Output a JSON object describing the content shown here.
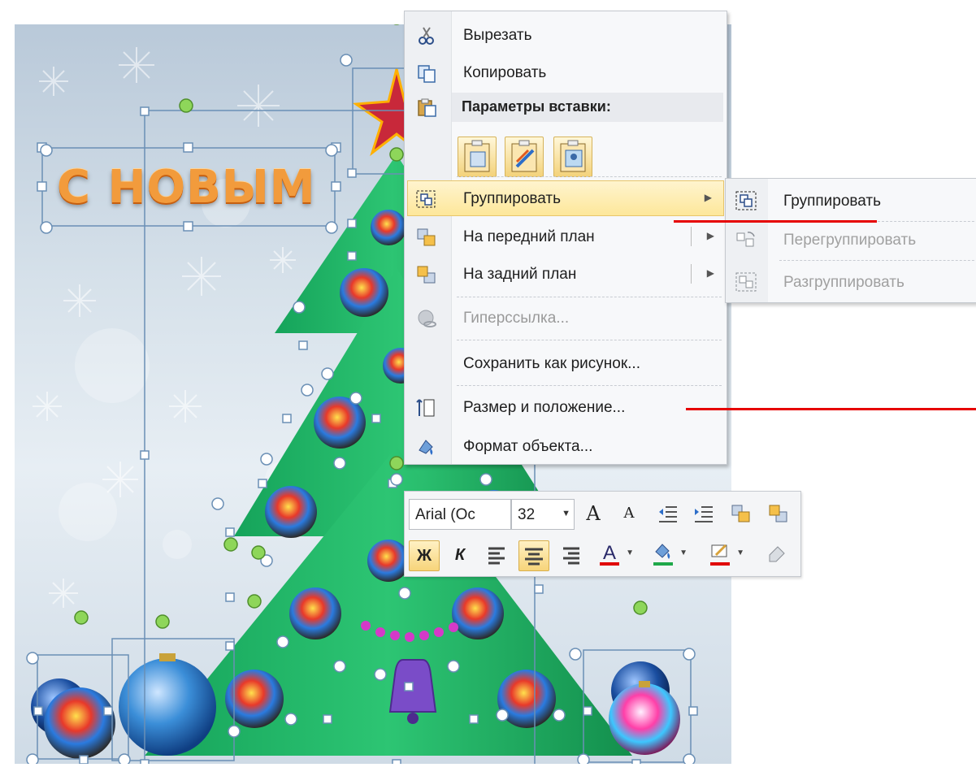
{
  "slide": {
    "title_text": "С НОВЫМ"
  },
  "context_menu": {
    "items": [
      {
        "label": "Вырезать",
        "icon": "scissors-icon"
      },
      {
        "label": "Копировать",
        "icon": "copy-icon"
      },
      {
        "label": "Параметры вставки:",
        "icon": "paste-icon"
      },
      {
        "label": "Группировать",
        "icon": "group-icon",
        "highlighted": true,
        "has_submenu": true
      },
      {
        "label": "На передний план",
        "icon": "bring-forward-icon",
        "has_submenu": true
      },
      {
        "label": "На задний план",
        "icon": "send-backward-icon",
        "has_submenu": true
      },
      {
        "label": "Гиперссылка...",
        "icon": "hyperlink-icon",
        "disabled": true
      },
      {
        "label": "Сохранить как рисунок...",
        "icon": ""
      },
      {
        "label": "Размер и положение...",
        "icon": "size-position-icon"
      },
      {
        "label": "Формат объекта...",
        "icon": "format-object-icon"
      }
    ],
    "paste_options": [
      "paste-keep-source-icon",
      "paste-merge-icon",
      "paste-picture-icon"
    ]
  },
  "submenu": {
    "items": [
      {
        "label": "Группировать",
        "icon": "group-icon"
      },
      {
        "label": "Перегруппировать",
        "icon": "regroup-icon",
        "disabled": true
      },
      {
        "label": "Разгруппировать",
        "icon": "ungroup-icon",
        "disabled": true
      }
    ]
  },
  "mini_toolbar": {
    "font_name": "Arial (Ос",
    "font_size": "32",
    "bold_label": "Ж",
    "italic_label": "К",
    "grow_label": "A",
    "shrink_label": "A",
    "font_color_label": "A",
    "colors": {
      "font": "#e00000",
      "fill": "#1fa84a",
      "outline": "#e00000",
      "accent": "#f7d47a"
    }
  },
  "annotations": {
    "line_color": "#e60000"
  }
}
